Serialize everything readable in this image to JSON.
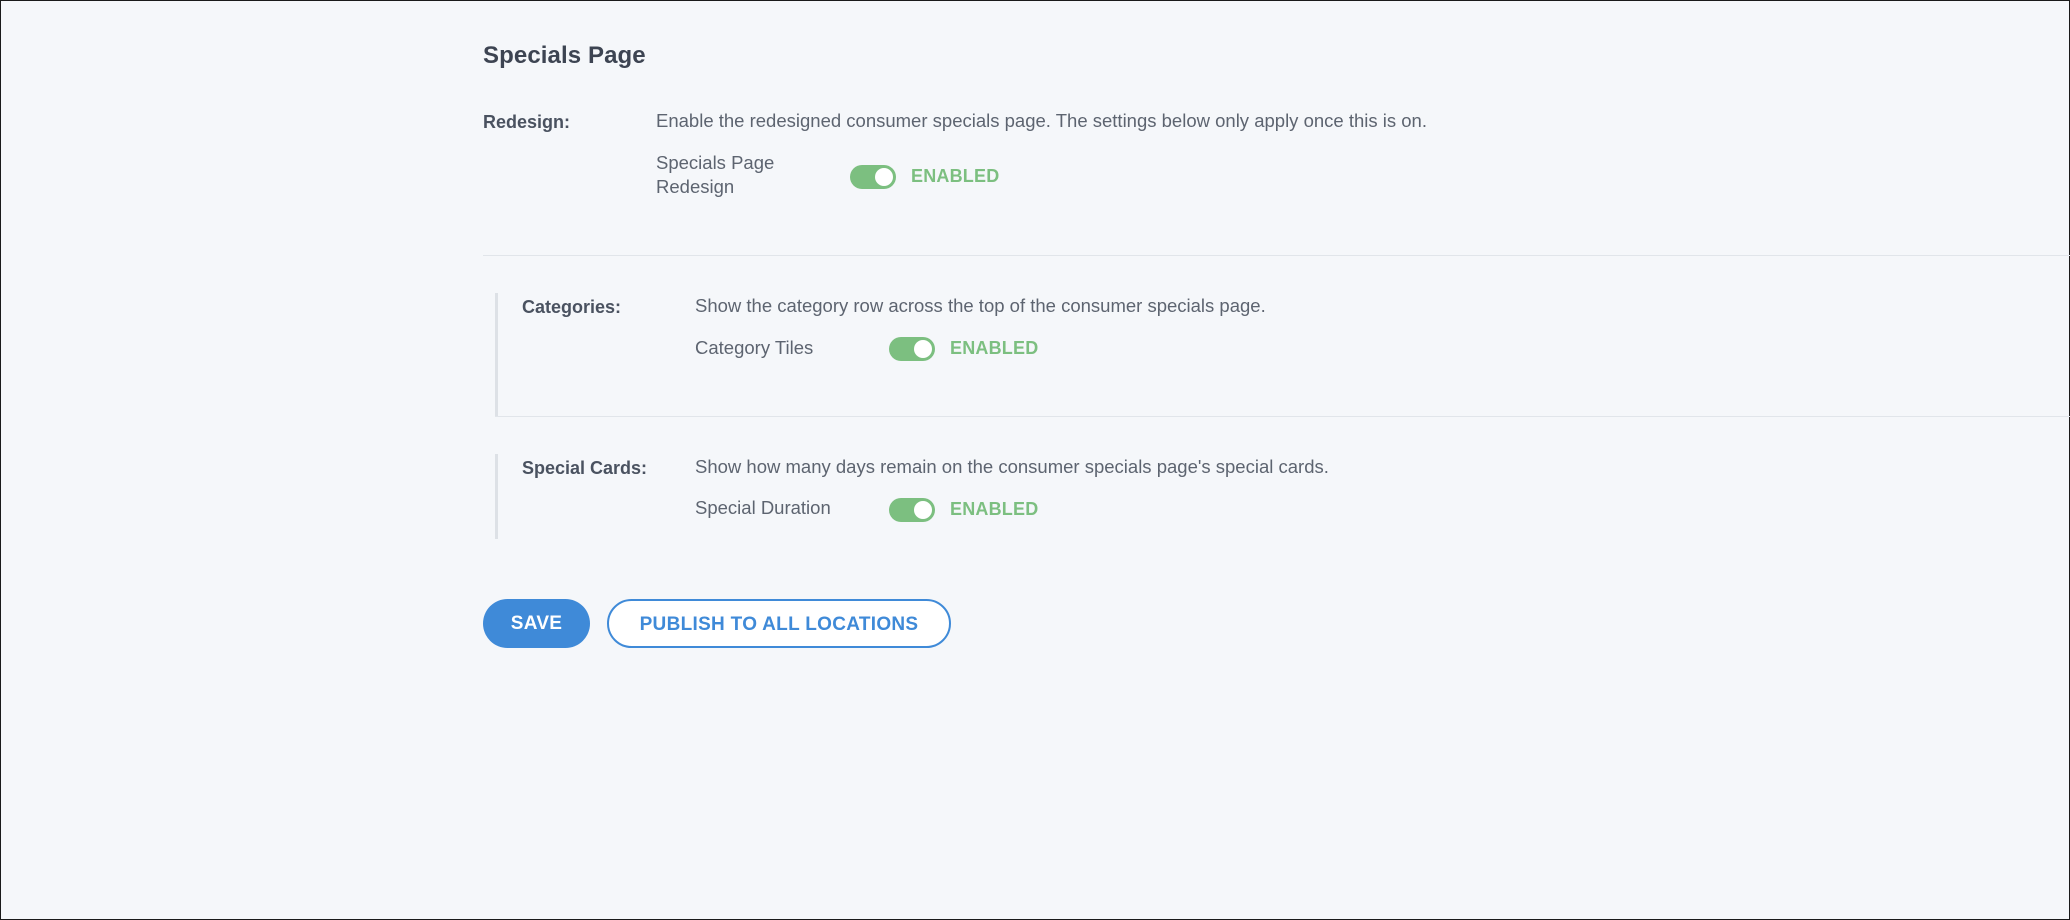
{
  "page": {
    "title": "Specials Page"
  },
  "redesign": {
    "label": "Redesign:",
    "description": "Enable the redesigned consumer specials page. The settings below only apply once this is on.",
    "setting_line1": "Specials Page",
    "setting_line2": "Redesign",
    "enabled": true,
    "status": "ENABLED"
  },
  "categories": {
    "label": "Categories:",
    "description": "Show the category row across the top of the consumer specials page.",
    "setting": "Category Tiles",
    "enabled": true,
    "status": "ENABLED"
  },
  "special_cards": {
    "label": "Special Cards:",
    "description": "Show how many days remain on the consumer specials page's special cards.",
    "setting": "Special Duration",
    "enabled": true,
    "status": "ENABLED"
  },
  "actions": {
    "save_label": "SAVE",
    "publish_label": "PUBLISH TO ALL LOCATIONS"
  },
  "colors": {
    "background": "#f5f7fa",
    "toggle_on": "#7cbf80",
    "primary": "#3f8ad8",
    "text": "#4a5260"
  },
  "icons": {
    "toggle": "toggle-switch-on"
  }
}
